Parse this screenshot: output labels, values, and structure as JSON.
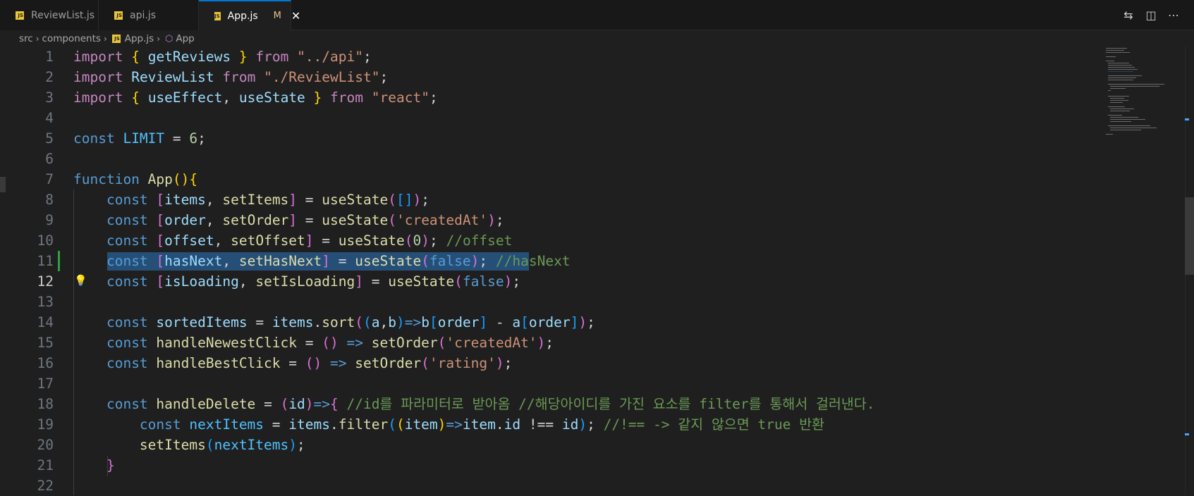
{
  "tabs": [
    {
      "label": "ReviewList.js",
      "icon": "js-file-icon"
    },
    {
      "label": "api.js",
      "icon": "js-file-icon"
    },
    {
      "label": "App.js",
      "icon": "js-file-icon",
      "active": true,
      "modified": "M"
    }
  ],
  "breadcrumb": [
    "src",
    "components",
    "App.js",
    "App"
  ],
  "editor": {
    "current_line": 12,
    "line_numbers": [
      "1",
      "2",
      "3",
      "4",
      "5",
      "6",
      "7",
      "8",
      "9",
      "10",
      "11",
      "12",
      "13",
      "14",
      "15",
      "16",
      "17",
      "18",
      "19",
      "20",
      "21",
      "22"
    ]
  },
  "colors": {
    "accent": "#0078d4",
    "keyword": "#c586c0",
    "storage": "#569cd6",
    "function": "#dcdcaa",
    "variable": "#9cdcfe",
    "string": "#ce9178",
    "comment": "#6a9955",
    "selection": "#264f78",
    "git_added": "#2ea043"
  }
}
